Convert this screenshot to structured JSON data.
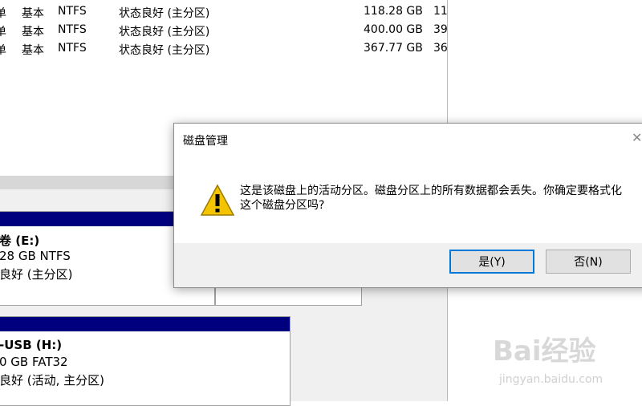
{
  "volumes": [
    {
      "layout": "单",
      "type": "基本",
      "fs": "NTFS",
      "status": "状态良好 (主分区)",
      "capacity": "118.28 GB",
      "free": "11"
    },
    {
      "layout": "单",
      "type": "基本",
      "fs": "NTFS",
      "status": "状态良好 (主分区)",
      "capacity": "400.00 GB",
      "free": "39"
    },
    {
      "layout": "单",
      "type": "基本",
      "fs": "NTFS",
      "status": "状态良好 (主分区)",
      "capacity": "367.77 GB",
      "free": "36"
    }
  ],
  "partitions": [
    {
      "name": "卷  (E:)",
      "size_fs": "28 GB NTFS",
      "status": "良好 (主分区)"
    },
    {
      "name": "-USB  (H:)",
      "size_fs": "0 GB FAT32",
      "status": "良好 (活动, 主分区)"
    }
  ],
  "dialog": {
    "title": "磁盘管理",
    "message_line1": "这是该磁盘上的活动分区。磁盘分区上的所有数据都会丢失。你确定要格式化",
    "message_line2": "这个磁盘分区吗?",
    "yes_label": "是(Y)",
    "no_label": "否(N)",
    "close_glyph": "✕",
    "icon": "warning-icon"
  },
  "watermark": {
    "brand": "Bai经验",
    "url": "jingyan.baidu.com"
  },
  "colors": {
    "partition_header": "#00007f",
    "default_button_border": "#0078d7",
    "warning_fill": "#f5c400"
  }
}
